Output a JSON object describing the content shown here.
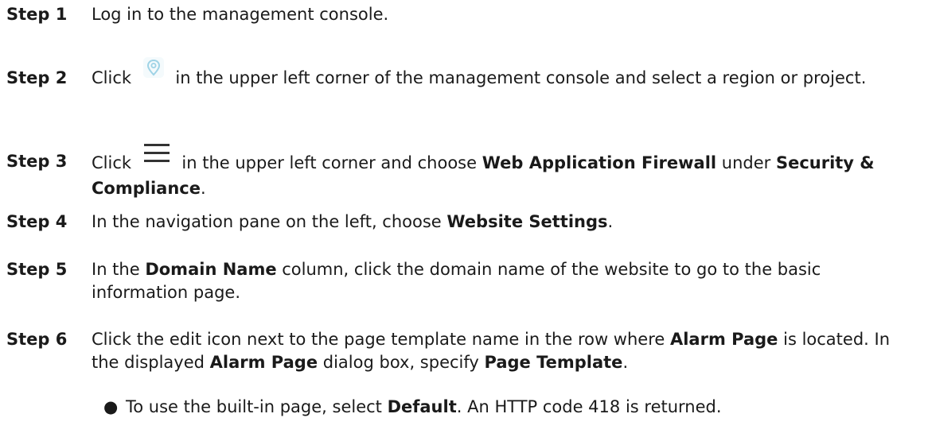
{
  "steps": [
    {
      "label": "Step 1",
      "segments": [
        {
          "t": "Log in to the management console."
        }
      ]
    },
    {
      "label": "Step 2",
      "segments": [
        {
          "t": "Click "
        },
        {
          "icon": "location-pin-icon"
        },
        {
          "t": " in the upper left corner of the management console and select a region or project."
        }
      ]
    },
    {
      "label": "Step 3",
      "segments": [
        {
          "t": "Click "
        },
        {
          "icon": "hamburger-menu-icon"
        },
        {
          "t": " in the upper left corner and choose "
        },
        {
          "b": "Web Application Firewall"
        },
        {
          "t": " under "
        },
        {
          "b": "Security & Compliance"
        },
        {
          "t": "."
        }
      ]
    },
    {
      "label": "Step 4",
      "segments": [
        {
          "t": "In the navigation pane on the left, choose "
        },
        {
          "b": "Website Settings"
        },
        {
          "t": "."
        }
      ]
    },
    {
      "label": "Step 5",
      "segments": [
        {
          "t": "In the "
        },
        {
          "b": "Domain Name"
        },
        {
          "t": " column, click the domain name of the website to go to the basic information page."
        }
      ]
    },
    {
      "label": "Step 6",
      "segments": [
        {
          "t": "Click the edit icon next to the page template name in the row where "
        },
        {
          "b": "Alarm Page"
        },
        {
          "t": " is located. In the displayed "
        },
        {
          "b": "Alarm Page"
        },
        {
          "t": " dialog box, specify "
        },
        {
          "b": "Page Template"
        },
        {
          "t": "."
        }
      ]
    }
  ],
  "bullets": [
    {
      "segments": [
        {
          "t": "To use the built-in page, select "
        },
        {
          "b": "Default"
        },
        {
          "t": ". An HTTP code 418 is returned."
        }
      ]
    }
  ],
  "bullet_glyph": "●",
  "colors": {
    "text": "#1a1a1a",
    "pin_icon": "#9fd3e6",
    "menu_icon": "#333333"
  }
}
